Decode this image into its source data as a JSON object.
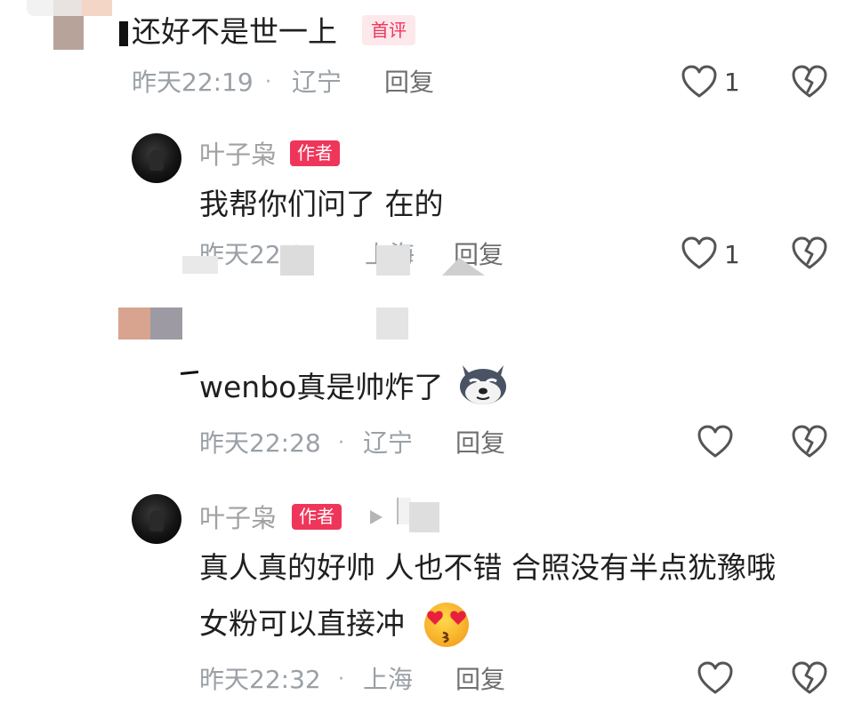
{
  "colors": {
    "accent": "#f0355a",
    "meta": "#9aa0a6",
    "text": "#1f1f1f"
  },
  "comment1": {
    "text": "还好不是世一上",
    "badge": "首评",
    "time": "昨天22:19",
    "location": "辽宁",
    "reply": "回复",
    "likes": "1"
  },
  "reply1": {
    "name": "叶子枭",
    "badge": "作者",
    "text": "我帮你们问了  在的",
    "time": "昨天22:2",
    "location": "上海",
    "reply": "回复",
    "likes": "1"
  },
  "comment2": {
    "text": "wenbo真是帅炸了",
    "time": "昨天22:28",
    "location": "辽宁",
    "reply": "回复"
  },
  "reply2": {
    "name": "叶子枭",
    "badge": "作者",
    "line1": "真人真的好帅  人也不错 合照没有半点犹豫哦",
    "line2": "女粉可以直接冲",
    "time": "昨天22:32",
    "location": "上海",
    "reply": "回复"
  },
  "separator": "·",
  "icons": {
    "like": "heart-outline-icon",
    "dislike": "broken-heart-icon",
    "dog_emoji": "husky-face-emoji",
    "heart_eyes_emoji": "heart-eyes-kiss-emoji"
  }
}
